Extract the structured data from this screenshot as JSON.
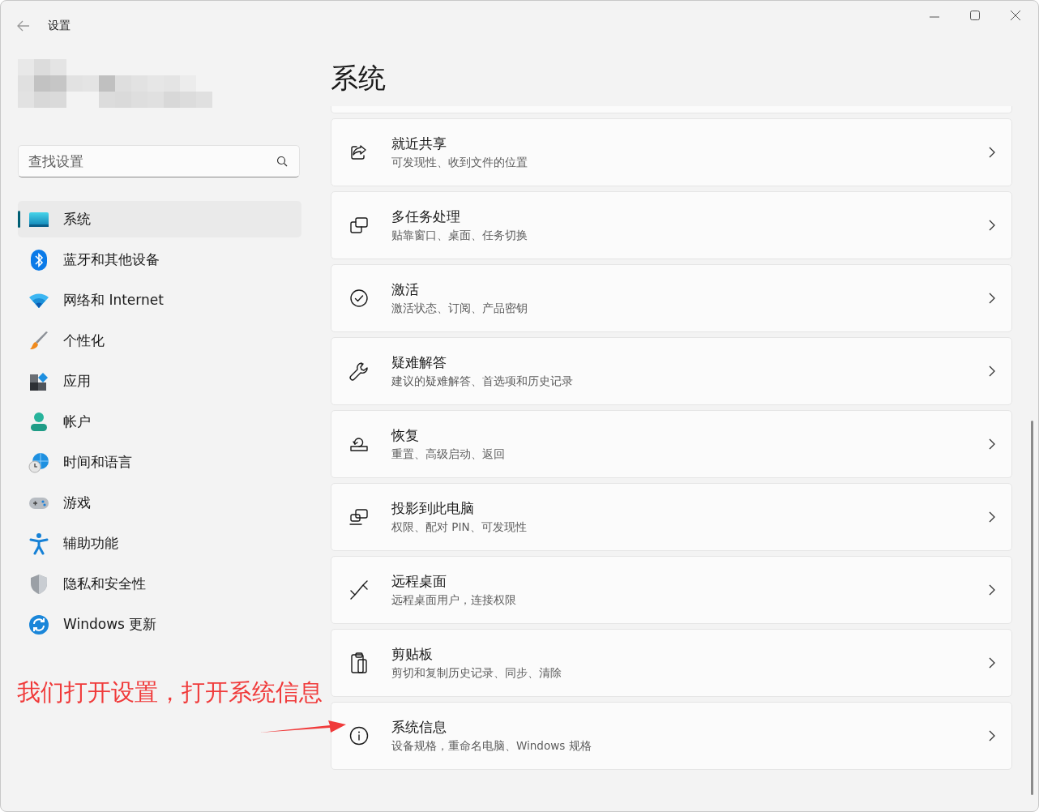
{
  "window": {
    "title": "设置"
  },
  "search": {
    "placeholder": "查找设置"
  },
  "sidebar": {
    "items": [
      {
        "label": "系统",
        "selected": true
      },
      {
        "label": "蓝牙和其他设备",
        "selected": false
      },
      {
        "label": "网络和 Internet",
        "selected": false
      },
      {
        "label": "个性化",
        "selected": false
      },
      {
        "label": "应用",
        "selected": false
      },
      {
        "label": "帐户",
        "selected": false
      },
      {
        "label": "时间和语言",
        "selected": false
      },
      {
        "label": "游戏",
        "selected": false
      },
      {
        "label": "辅助功能",
        "selected": false
      },
      {
        "label": "隐私和安全性",
        "selected": false
      },
      {
        "label": "Windows 更新",
        "selected": false
      }
    ]
  },
  "page_title": "系统",
  "settings": [
    {
      "title": "就近共享",
      "subtitle": "可发现性、收到文件的位置"
    },
    {
      "title": "多任务处理",
      "subtitle": "贴靠窗口、桌面、任务切换"
    },
    {
      "title": "激活",
      "subtitle": "激活状态、订阅、产品密钥"
    },
    {
      "title": "疑难解答",
      "subtitle": "建议的疑难解答、首选项和历史记录"
    },
    {
      "title": "恢复",
      "subtitle": "重置、高级启动、返回"
    },
    {
      "title": "投影到此电脑",
      "subtitle": "权限、配对 PIN、可发现性"
    },
    {
      "title": "远程桌面",
      "subtitle": "远程桌面用户，连接权限"
    },
    {
      "title": "剪贴板",
      "subtitle": "剪切和复制历史记录、同步、清除"
    },
    {
      "title": "系统信息",
      "subtitle": "设备规格，重命名电脑、Windows 规格"
    }
  ],
  "annotation": {
    "text": "我们打开设置，打开系统信息"
  }
}
